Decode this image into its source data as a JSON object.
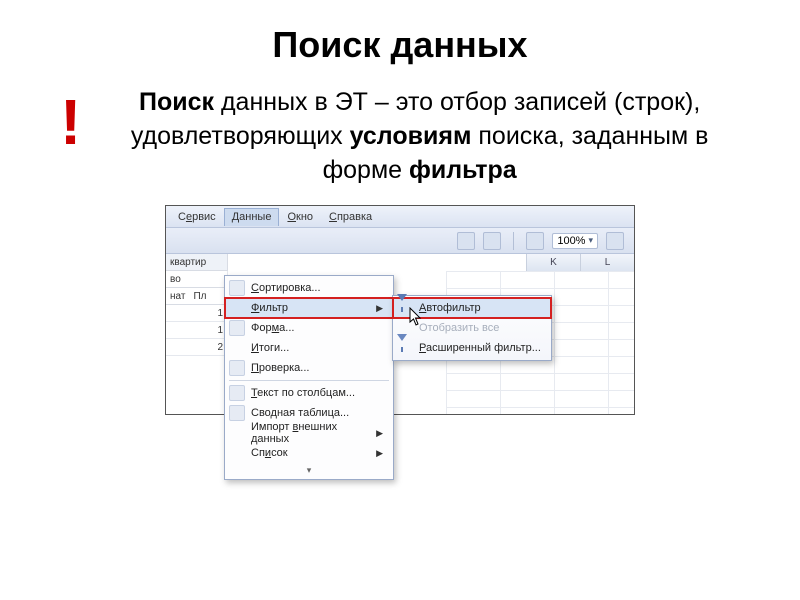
{
  "slide": {
    "title": "Поиск данных",
    "bang": "!",
    "paragraph_html": "<b>Поиск</b> данных в ЭТ – это отбор записей (строк), удовлетворяющих <b>условиям</b> поиска, заданным в форме <b>фильтра</b>"
  },
  "menubar": {
    "items": [
      {
        "label": "С<u>е</u>рвис",
        "open": false
      },
      {
        "label": "<u>Д</u>анные",
        "open": true
      },
      {
        "label": "<u>О</u>кно",
        "open": false
      },
      {
        "label": "<u>С</u>правка",
        "open": false
      }
    ]
  },
  "toolbar": {
    "zoom": "100%"
  },
  "dropdown": {
    "items": [
      {
        "label": "<u>С</u>ортировка...",
        "arrow": false
      },
      {
        "label": "<u>Ф</u>ильтр",
        "arrow": true,
        "highlight": true,
        "boxed": true
      },
      {
        "label": "Фор<u>м</u>а...",
        "arrow": false
      },
      {
        "label": "<u>И</u>тоги...",
        "arrow": false
      },
      {
        "label": "<u>П</u>роверка...",
        "arrow": false
      },
      {
        "sep": true
      },
      {
        "label": "<u>Т</u>екст по столбцам...",
        "arrow": false
      },
      {
        "label": "Сво<u>д</u>ная таблица...",
        "arrow": false
      },
      {
        "label": "Импорт <u>в</u>нешних данных",
        "arrow": true
      },
      {
        "label": "Сп<u>и</u>сок",
        "arrow": true
      },
      {
        "expand": true
      }
    ]
  },
  "submenu": {
    "items": [
      {
        "label": "<u>А</u>втофильтр",
        "boxed": true,
        "highlight": true,
        "icon": "funnel"
      },
      {
        "label": "Отобразить все",
        "disabled": true
      },
      {
        "label": "<u>Р</u>асширенный фильтр..."
      }
    ]
  },
  "sheet": {
    "left_header": "квартир",
    "left_rows": [
      "во",
      "нат",
      "Пл"
    ],
    "left_nums": [
      "1",
      "1",
      "2"
    ],
    "col_letters": [
      "K",
      "L"
    ]
  }
}
